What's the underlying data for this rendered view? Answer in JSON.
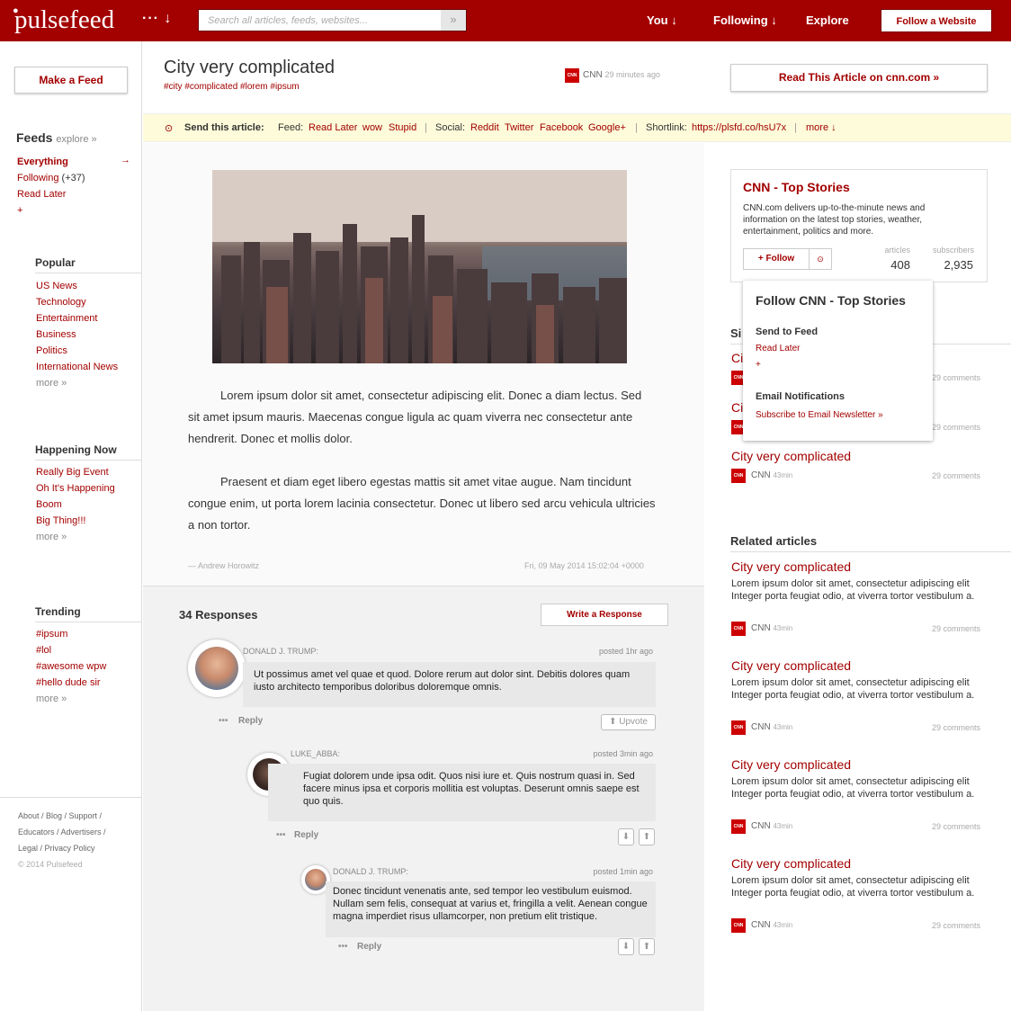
{
  "header": {
    "logo": "pulsefeed",
    "menu_dots": "··· ↓",
    "search_placeholder": "Search all articles, feeds, websites...",
    "search_button": "»",
    "nav": [
      "You ↓",
      "Following ↓",
      "Explore"
    ],
    "follow_website": "Follow a Website"
  },
  "sidebar": {
    "make_feed": "Make a Feed",
    "feeds_title": "Feeds",
    "feeds_explore": "explore »",
    "feeds": [
      {
        "label": "Everything",
        "arrow": "→"
      },
      {
        "label": "Following",
        "count": "(+37)"
      },
      {
        "label": "Read Later"
      },
      {
        "label": "+"
      }
    ],
    "popular": {
      "title": "Popular",
      "items": [
        "US News",
        "Technology",
        "Entertainment",
        "Business",
        "Politics",
        "International News"
      ],
      "more": "more »"
    },
    "happening": {
      "title": "Happening Now",
      "items": [
        "Really Big Event",
        "Oh It's Happening",
        "Boom",
        "Big Thing!!!"
      ],
      "more": "more »"
    },
    "trending": {
      "title": "Trending",
      "items": [
        "#ipsum",
        "#lol",
        "#awesome wpw",
        "#hello dude sir"
      ],
      "more": "more »"
    },
    "footer": [
      "About / Blog / Support /",
      "Educators / Advertisers /",
      "Legal / Privacy Policy",
      "© 2014 Pulsefeed"
    ]
  },
  "article": {
    "title": "City very complicated",
    "tags": "#city  #complicated  #lorem  #ipsum",
    "source": "CNN",
    "time": "29 minutes ago",
    "read_button": "Read This Article on cnn.com »",
    "paragraphs": [
      "Lorem ipsum dolor sit amet, consectetur adipiscing elit. Donec a diam lectus. Sed sit amet ipsum mauris. Maecenas congue ligula ac quam viverra nec consectetur ante hendrerit. Donec et mollis dolor.",
      "Praesent et diam eget libero egestas mattis sit amet vitae augue. Nam tincidunt congue enim, ut porta lorem lacinia consectetur. Donec ut libero sed arcu vehicula ultricies a non tortor."
    ],
    "author": "— Andrew Horowitz",
    "date": "Fri, 09 May 2014 15:02:04 +0000"
  },
  "sharebar": {
    "icon": "⊙",
    "label": "Send this article:",
    "feed_label": "Feed:",
    "feed_links": [
      "Read Later",
      "wow",
      "Stupid"
    ],
    "social_label": "Social:",
    "social_links": [
      "Reddit",
      "Twitter",
      "Facebook",
      "Google+"
    ],
    "shortlink_label": "Shortlink:",
    "shortlink": "https://plsfd.co/hsU7x",
    "more": "more ↓",
    "sep": "|"
  },
  "responses": {
    "count_label": "34 Responses",
    "write_button": "Write a Response",
    "comments": [
      {
        "user": "DONALD J. TRUMP:",
        "time": "posted 1hr ago",
        "body": "Ut possimus amet vel quae et quod. Dolore rerum aut dolor sint. Debitis dolores quam iusto architecto temporibus doloribus doloremque omnis.",
        "reply": "Reply",
        "upvote": "⬆ Upvote"
      },
      {
        "user": "LUKE_ABBA:",
        "time": "posted 3min ago",
        "body": "Fugiat dolorem unde ipsa odit. Quos nisi iure et. Quis nostrum quasi in. Sed facere minus ipsa et corporis mollitia est voluptas. Deserunt omnis saepe est quo quis.",
        "reply": "Reply"
      },
      {
        "user": "DONALD J. TRUMP:",
        "time": "posted 1min ago",
        "body": "Donec tincidunt venenatis ante, sed tempor leo vestibulum euismod. Nullam sem felis, consequat at varius et, fringilla a velit. Aenean congue magna imperdiet risus ullamcorper, non pretium elit tristique.",
        "reply": "Reply"
      }
    ],
    "reply_dots": "•••",
    "down": "⬇",
    "up": "⬆"
  },
  "source_card": {
    "title": "CNN - Top Stories",
    "desc": "CNN.com delivers up-to-the-minute news and information on the latest top stories, weather, entertainment, politics and more.",
    "follow": "+ Follow",
    "target": "⊙",
    "articles_label": "articles",
    "articles": "408",
    "subscribers_label": "subscribers",
    "subscribers": "2,935"
  },
  "popover": {
    "title": "Follow CNN - Top Stories",
    "send_to_feed": "Send to Feed",
    "read_later": "Read Later",
    "plus": "+",
    "email_title": "Email Notifications",
    "subscribe": "Subscribe to Email Newsletter »"
  },
  "similar": {
    "title_partial": "Si",
    "items": [
      {
        "title_partial": "Ci",
        "comments": "29 comments"
      },
      {
        "title_partial": "Ci",
        "comments": "29 comments"
      },
      {
        "title": "City very complicated",
        "source": "CNN",
        "time": "43min",
        "comments": "29 comments"
      }
    ]
  },
  "related": {
    "title": "Related articles",
    "items": [
      {
        "title": "City very complicated",
        "desc": "Lorem ipsum dolor sit amet, consectetur adipiscing elit Integer porta feugiat odio, at viverra tortor vestibulum a.",
        "source": "CNN",
        "time": "43min",
        "comments": "29 comments"
      },
      {
        "title": "City very complicated",
        "desc": "Lorem ipsum dolor sit amet, consectetur adipiscing elit Integer porta feugiat odio, at viverra tortor vestibulum a.",
        "source": "CNN",
        "time": "43min",
        "comments": "29 comments"
      },
      {
        "title": "City very complicated",
        "desc": "Lorem ipsum dolor sit amet, consectetur adipiscing elit Integer porta feugiat odio, at viverra tortor vestibulum a.",
        "source": "CNN",
        "time": "43min",
        "comments": "29 comments"
      },
      {
        "title": "City very complicated",
        "desc": "Lorem ipsum dolor sit amet, consectetur adipiscing elit Integer porta feugiat odio, at viverra tortor vestibulum a.",
        "source": "CNN",
        "time": "43min",
        "comments": "29 comments"
      }
    ]
  },
  "cnn_logo_text": "CNN",
  "colors": {
    "brand": "#a30000",
    "highlight": "#fdfbd9"
  }
}
